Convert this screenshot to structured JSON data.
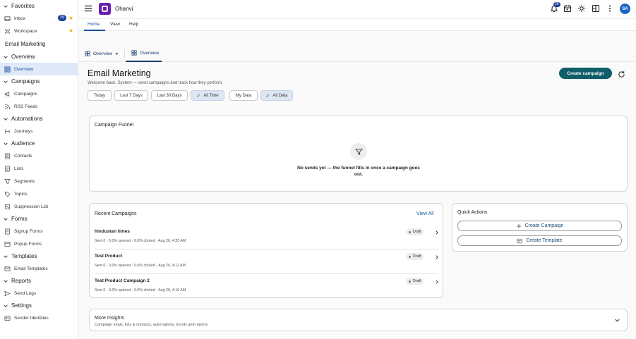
{
  "sidebar": {
    "favorites_title": "Favorites",
    "inbox_label": "Inbox",
    "inbox_count": "29",
    "workspace_label": "Workspace",
    "app_title": "Email Marketing",
    "overview_section": "Overview",
    "overview_item": "Overview",
    "campaigns_section": "Campaigns",
    "campaigns_item": "Campaigns",
    "rss_item": "RSS Feeds",
    "automations_section": "Automations",
    "journeys_item": "Journeys",
    "audience_section": "Audience",
    "contacts_item": "Contacts",
    "lists_item": "Lists",
    "segments_item": "Segments",
    "topics_item": "Topics",
    "suppression_item": "Suppression List",
    "forms_section": "Forms",
    "signup_item": "Signup Forms",
    "popup_item": "Popup Forms",
    "templates_section": "Templates",
    "email_templates_item": "Email Templates",
    "reports_section": "Reports",
    "send_logs_item": "Send Logs",
    "settings_section": "Settings",
    "sender_identities_item": "Sender Identities"
  },
  "topbar": {
    "app_name": "Ohanvi",
    "notification_count": "29",
    "avatar_initials": "SA"
  },
  "ribbon": {
    "home": "Home",
    "view": "View",
    "help": "Help"
  },
  "pagenav": {
    "overview_dropdown": "Overview",
    "overview_tab": "Overview"
  },
  "header": {
    "title": "Email Marketing",
    "subtitle": "Welcome back, System — send campaigns and track how they perform.",
    "create_campaign": "Create campaign"
  },
  "filters": {
    "today": "Today",
    "last7": "Last 7 Days",
    "last30": "Last 30 Days",
    "all_time": "All Time",
    "my_data": "My Data",
    "all_data": "All Data"
  },
  "funnel": {
    "title": "Campaign Funnel",
    "empty_line1": "No sends yet — the funnel fills in once a campaign goes",
    "empty_line2": "out."
  },
  "recent": {
    "title": "Recent Campaigns",
    "view_all": "View All",
    "rows": [
      {
        "name": "hindustan times",
        "meta": "Sent 0 · 0.0% opened · 0.0% clicked · Aug 20, 4:35 AM",
        "status": "Draft"
      },
      {
        "name": "Test Product",
        "meta": "Sent 0 · 0.0% opened · 0.0% clicked · Aug 20, 4:11 AM",
        "status": "Draft"
      },
      {
        "name": "Test Product Campaign 2",
        "meta": "Sent 0 · 0.0% opened · 0.0% clicked · Aug 20, 4:10 AM",
        "status": "Draft"
      }
    ]
  },
  "quick_actions": {
    "title": "Quick Actions",
    "create_campaign": "Create Campaign",
    "create_template": "Create Template"
  },
  "insights": {
    "title": "More Insights",
    "subtitle": "Campaign totals, lists & contacts, automations, trends and reports"
  },
  "colors": {
    "primary": "#0f5e68",
    "accent_blue": "#1a4f9c",
    "logo_purple": "#6a1fb0",
    "badge_navy": "#1b3f9a",
    "star": "#f2b400"
  }
}
